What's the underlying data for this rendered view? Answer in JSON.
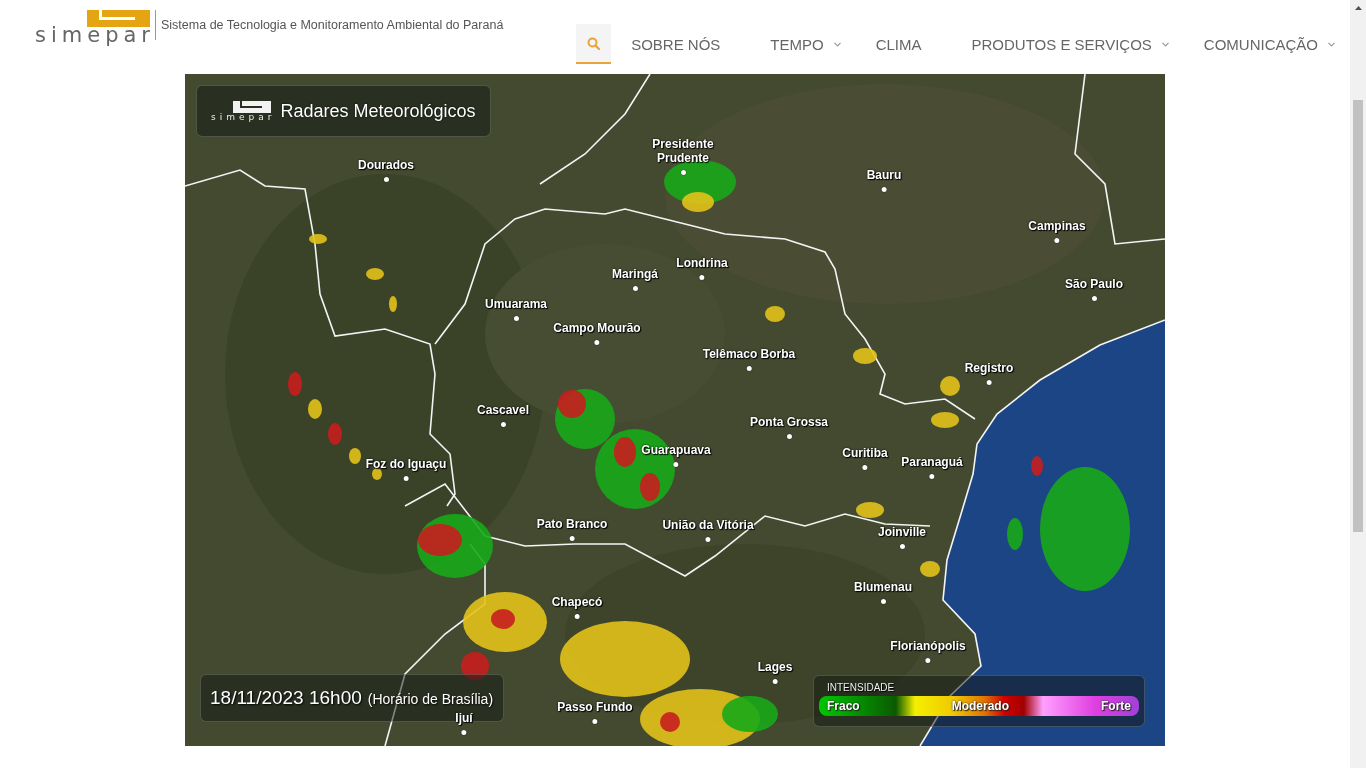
{
  "header": {
    "logo_text": "simepar",
    "tagline": "Sistema de Tecnologia e Monitoramento Ambiental do Paraná"
  },
  "nav": [
    {
      "label": "SOBRE NÓS",
      "dropdown": false
    },
    {
      "label": "TEMPO",
      "dropdown": true
    },
    {
      "label": "CLIMA",
      "dropdown": false
    },
    {
      "label": "PRODUTOS E SERVIÇOS",
      "dropdown": true
    },
    {
      "label": "COMUNICAÇÃO",
      "dropdown": true
    }
  ],
  "radar": {
    "logo_text": "simepar",
    "title": "Radares Meteorológicos",
    "cities": [
      "Presidente Prudente",
      "Dourados",
      "Bauru",
      "Campinas",
      "Londrina",
      "Maringá",
      "São Paulo",
      "Umuarama",
      "Campo Mourão",
      "Telêmaco Borba",
      "Registro",
      "Cascavel",
      "Ponta Grossa",
      "Guarapuava",
      "Curitiba",
      "Paranaguá",
      "Foz do Iguaçu",
      "Pato Branco",
      "União da Vitória",
      "Joinville",
      "Blumenau",
      "Chapecó",
      "Florianópolis",
      "Lages",
      "Passo Fundo",
      "Ijuí"
    ],
    "timestamp": "18/11/2023 16h00",
    "timezone": "(Horário de Brasília)",
    "legend": {
      "title": "INTENSIDADE",
      "labels": [
        "Fraco",
        "Moderado",
        "Forte"
      ]
    }
  }
}
